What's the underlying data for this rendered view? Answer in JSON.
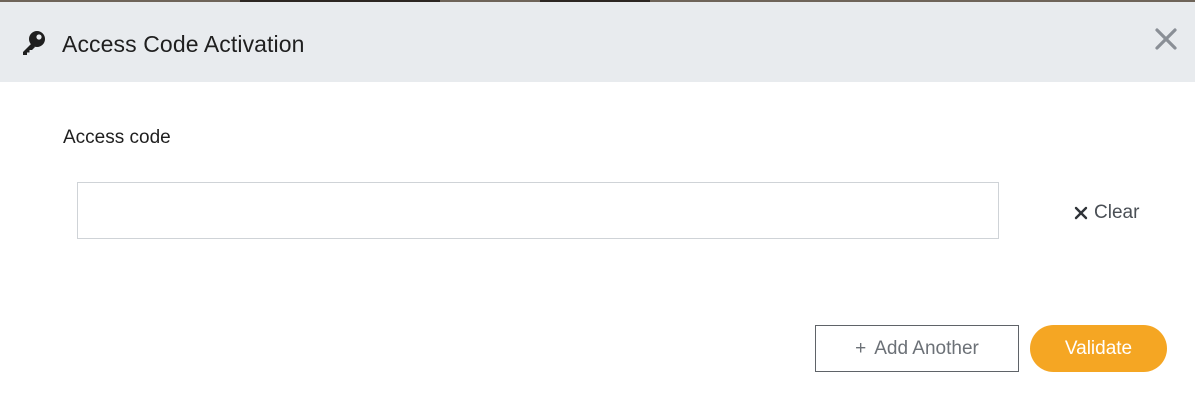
{
  "dialog": {
    "title": "Access Code Activation",
    "icon": "key-icon",
    "close_icon": "close-icon"
  },
  "form": {
    "field_label": "Access code",
    "input_value": "",
    "input_placeholder": "",
    "clear_label": "Clear"
  },
  "actions": {
    "add_another_plus": "+",
    "add_another_label": "Add Another",
    "validate_label": "Validate"
  },
  "colors": {
    "header_background": "#e8ebee",
    "accent": "#f5a623",
    "input_border": "#cfd3d7"
  }
}
